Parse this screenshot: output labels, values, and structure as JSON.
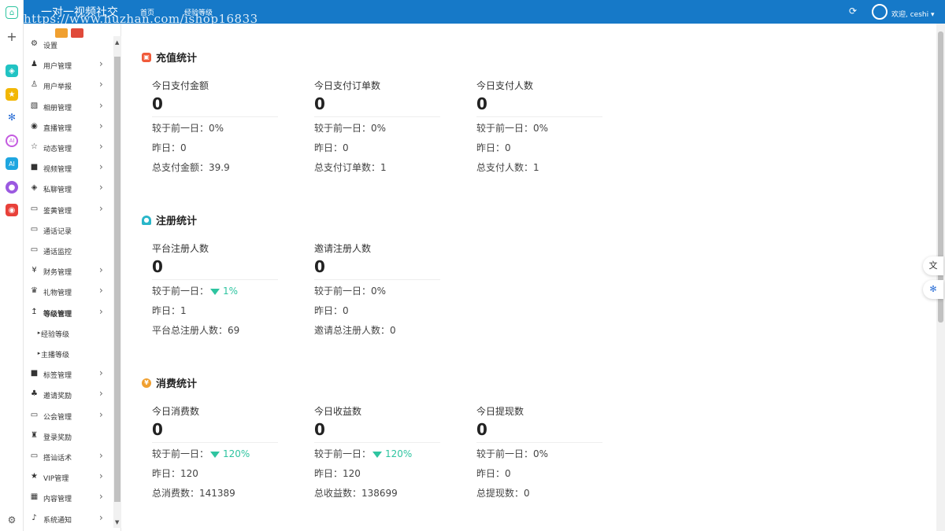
{
  "header": {
    "app_title": "一对一视频社交",
    "watermark": "https://www.huzhan.com/ishop16833",
    "tabs": [
      {
        "label": "首页",
        "active": true
      },
      {
        "label": "经验等级",
        "active": false
      }
    ],
    "welcome": "欢迎, ceshi"
  },
  "sidebar": {
    "items": [
      {
        "label": "设置",
        "icon": "gears-icon",
        "arrow": false
      },
      {
        "label": "用户管理",
        "icon": "users-icon",
        "arrow": true
      },
      {
        "label": "用户举报",
        "icon": "report-icon",
        "arrow": true
      },
      {
        "label": "相册管理",
        "icon": "image-icon",
        "arrow": true
      },
      {
        "label": "直播管理",
        "icon": "eye-icon",
        "arrow": true
      },
      {
        "label": "动态管理",
        "icon": "star-outline-icon",
        "arrow": true
      },
      {
        "label": "视频管理",
        "icon": "video-camera-icon",
        "arrow": true
      },
      {
        "label": "私聊管理",
        "icon": "telegram-icon",
        "arrow": true
      },
      {
        "label": "鉴黄管理",
        "icon": "monitor-icon",
        "arrow": true
      },
      {
        "label": "通话记录",
        "icon": "monitor-icon",
        "arrow": false
      },
      {
        "label": "通话监控",
        "icon": "monitor-icon",
        "arrow": false
      },
      {
        "label": "财务管理",
        "icon": "yen-icon",
        "arrow": true
      },
      {
        "label": "礼物管理",
        "icon": "gift-icon",
        "arrow": true
      },
      {
        "label": "等级管理",
        "icon": "level-up-icon",
        "arrow": true,
        "active": true
      },
      {
        "label": "经验等级",
        "icon": "caret-right-icon",
        "sub": true
      },
      {
        "label": "主播等级",
        "icon": "caret-right-icon",
        "sub": true
      },
      {
        "label": "标签管理",
        "icon": "bookmark-icon",
        "arrow": true
      },
      {
        "label": "邀请奖励",
        "icon": "sitemap-icon",
        "arrow": true
      },
      {
        "label": "公会管理",
        "icon": "monitor-icon",
        "arrow": true
      },
      {
        "label": "登录奖励",
        "icon": "trophy-icon",
        "arrow": false
      },
      {
        "label": "搭讪话术",
        "icon": "monitor-icon",
        "arrow": true
      },
      {
        "label": "VIP管理",
        "icon": "star-icon",
        "arrow": true
      },
      {
        "label": "内容管理",
        "icon": "grid-icon",
        "arrow": true
      },
      {
        "label": "系统通知",
        "icon": "bell-icon",
        "arrow": true
      }
    ]
  },
  "sections": {
    "recharge": {
      "title": "充值统计",
      "cards": [
        {
          "label": "今日支付金额",
          "value": "0",
          "compare": "较于前一日：0%",
          "yesterday": "昨日：0",
          "total": "总支付金额：39.9"
        },
        {
          "label": "今日支付订单数",
          "value": "0",
          "compare": "较于前一日：0%",
          "yesterday": "昨日：0",
          "total": "总支付订单数：1"
        },
        {
          "label": "今日支付人数",
          "value": "0",
          "compare": "较于前一日：0%",
          "yesterday": "昨日：0",
          "total": "总支付人数：1"
        }
      ]
    },
    "register": {
      "title": "注册统计",
      "cards": [
        {
          "label": "平台注册人数",
          "value": "0",
          "compare_prefix": "较于前一日：",
          "compare_change": "1%",
          "yesterday": "昨日：1",
          "total": "平台总注册人数：69"
        },
        {
          "label": "邀请注册人数",
          "value": "0",
          "compare": "较于前一日：0%",
          "yesterday": "昨日：0",
          "total": "邀请总注册人数：0"
        }
      ]
    },
    "consume": {
      "title": "消费统计",
      "cards": [
        {
          "label": "今日消费数",
          "value": "0",
          "compare_prefix": "较于前一日：",
          "compare_change": "120%",
          "yesterday": "昨日：120",
          "total": "总消费数：141389"
        },
        {
          "label": "今日收益数",
          "value": "0",
          "compare_prefix": "较于前一日：",
          "compare_change": "120%",
          "yesterday": "昨日：120",
          "total": "总收益数：138699"
        },
        {
          "label": "今日提现数",
          "value": "0",
          "compare": "较于前一日：0%",
          "yesterday": "昨日：0",
          "total": "总提现数：0"
        }
      ]
    }
  },
  "colors": {
    "header": "#1679c8",
    "trend_down": "#2ec4a0",
    "recharge_icon": "#f05a3a",
    "register_icon": "#29b6c9",
    "consume_icon": "#f0a030"
  }
}
